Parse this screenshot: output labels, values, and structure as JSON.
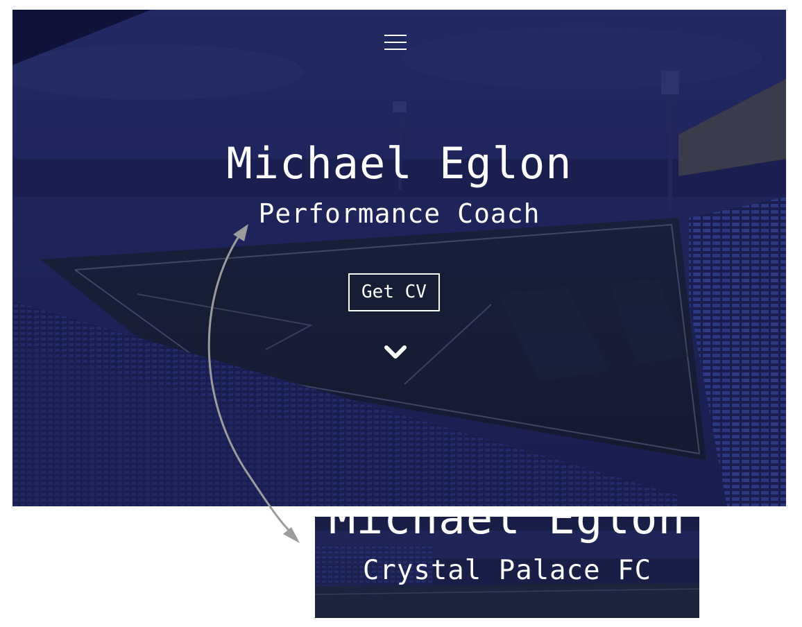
{
  "hero": {
    "name": "Michael Eglon",
    "role": "Performance Coach",
    "cv_button_label": "Get CV"
  },
  "icons": {
    "menu": "hamburger-menu-icon",
    "scroll": "chevron-down-icon"
  },
  "crop_preview": {
    "name": "Michael Eglon",
    "subtitle": "Crystal Palace FC"
  },
  "colors": {
    "overlay": "#1a1f4a",
    "text": "#ffffff",
    "arrow": "#9a9a9a"
  }
}
